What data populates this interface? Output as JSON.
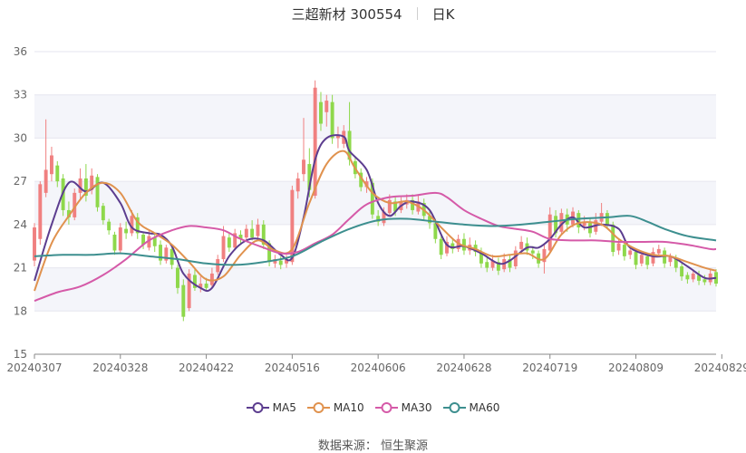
{
  "title": {
    "name": "三超新材 300554",
    "period": "日K"
  },
  "source": "数据来源： 恒生聚源",
  "colors": {
    "up": "#f08080",
    "down": "#8ed84b",
    "grid": "#e6e6ef",
    "band": "#f4f5fa",
    "axis": "#888888"
  },
  "chart_data": {
    "type": "candlestick",
    "ylim": [
      15,
      36
    ],
    "yticks": [
      15,
      18,
      21,
      24,
      27,
      30,
      33,
      36
    ],
    "x_tick_labels": [
      {
        "index": 0,
        "label": "20240307"
      },
      {
        "index": 15,
        "label": "20240328"
      },
      {
        "index": 30,
        "label": "20240422"
      },
      {
        "index": 45,
        "label": "20240516"
      },
      {
        "index": 60,
        "label": "20240606"
      },
      {
        "index": 75,
        "label": "20240628"
      },
      {
        "index": 90,
        "label": "20240719"
      },
      {
        "index": 105,
        "label": "20240809"
      },
      {
        "index": 120,
        "label": "20240829"
      }
    ],
    "candles": [
      [
        21.5,
        23.8,
        21.1,
        24.1
      ],
      [
        23.0,
        26.8,
        22.6,
        27.0
      ],
      [
        26.2,
        27.8,
        25.9,
        31.3
      ],
      [
        27.5,
        28.8,
        27.0,
        29.4
      ],
      [
        28.1,
        27.0,
        26.6,
        28.4
      ],
      [
        27.2,
        25.0,
        24.6,
        27.5
      ],
      [
        25.0,
        24.5,
        24.0,
        25.6
      ],
      [
        24.5,
        26.2,
        24.3,
        26.5
      ],
      [
        26.2,
        27.2,
        25.8,
        27.9
      ],
      [
        27.2,
        26.0,
        25.6,
        28.2
      ],
      [
        26.4,
        27.4,
        26.1,
        27.9
      ],
      [
        27.3,
        25.2,
        24.9,
        27.5
      ],
      [
        25.3,
        24.3,
        24.0,
        25.5
      ],
      [
        24.2,
        23.6,
        23.3,
        24.4
      ],
      [
        23.3,
        22.2,
        21.9,
        23.5
      ],
      [
        22.2,
        23.8,
        22.0,
        24.1
      ],
      [
        23.7,
        23.4,
        23.0,
        24.2
      ],
      [
        23.4,
        24.6,
        23.2,
        25.0
      ],
      [
        24.5,
        23.4,
        23.0,
        24.8
      ],
      [
        23.3,
        22.6,
        22.3,
        23.5
      ],
      [
        22.4,
        23.2,
        22.2,
        23.6
      ],
      [
        23.1,
        22.5,
        22.1,
        23.3
      ],
      [
        22.6,
        21.5,
        21.2,
        22.9
      ],
      [
        21.5,
        22.4,
        21.3,
        22.6
      ],
      [
        22.3,
        21.2,
        20.9,
        22.5
      ],
      [
        21.0,
        19.6,
        19.2,
        21.2
      ],
      [
        19.8,
        17.6,
        17.3,
        20.2
      ],
      [
        18.2,
        20.6,
        18.0,
        20.9
      ],
      [
        20.5,
        19.6,
        19.4,
        21.0
      ],
      [
        19.6,
        19.9,
        19.3,
        20.4
      ],
      [
        19.9,
        19.6,
        19.4,
        20.3
      ],
      [
        19.8,
        20.6,
        19.6,
        21.0
      ],
      [
        20.7,
        21.6,
        20.5,
        21.9
      ],
      [
        21.6,
        23.2,
        21.4,
        23.9
      ],
      [
        23.1,
        22.4,
        22.1,
        23.4
      ],
      [
        22.4,
        23.4,
        22.2,
        23.7
      ],
      [
        23.3,
        23.0,
        22.7,
        23.6
      ],
      [
        23.1,
        23.7,
        22.9,
        24.0
      ],
      [
        23.7,
        23.1,
        22.9,
        24.3
      ],
      [
        23.2,
        24.0,
        23.0,
        24.4
      ],
      [
        24.0,
        22.6,
        22.3,
        24.3
      ],
      [
        22.7,
        21.4,
        21.1,
        22.9
      ],
      [
        21.3,
        21.6,
        21.0,
        21.9
      ],
      [
        21.5,
        21.2,
        20.9,
        21.8
      ],
      [
        21.3,
        21.6,
        21.0,
        21.9
      ],
      [
        21.4,
        26.4,
        21.2,
        26.7
      ],
      [
        26.3,
        27.2,
        25.8,
        27.6
      ],
      [
        27.5,
        28.5,
        27.0,
        31.4
      ],
      [
        28.2,
        26.4,
        25.9,
        29.3
      ],
      [
        26.0,
        33.5,
        25.8,
        34.0
      ],
      [
        32.5,
        31.0,
        30.5,
        33.2
      ],
      [
        31.8,
        32.6,
        30.8,
        33.0
      ],
      [
        32.5,
        30.0,
        29.6,
        33.0
      ],
      [
        30.0,
        30.2,
        29.3,
        30.8
      ],
      [
        29.6,
        30.5,
        29.3,
        30.9
      ],
      [
        30.5,
        28.5,
        28.1,
        32.5
      ],
      [
        28.4,
        27.5,
        27.2,
        28.7
      ],
      [
        27.6,
        26.6,
        26.3,
        27.9
      ],
      [
        26.6,
        27.0,
        26.2,
        27.3
      ],
      [
        26.9,
        24.7,
        24.4,
        27.2
      ],
      [
        24.6,
        24.2,
        23.9,
        25.0
      ],
      [
        24.1,
        24.9,
        23.9,
        25.2
      ],
      [
        24.8,
        25.7,
        24.6,
        26.1
      ],
      [
        25.6,
        24.9,
        24.6,
        25.9
      ],
      [
        25.0,
        25.6,
        24.8,
        25.9
      ],
      [
        25.4,
        25.7,
        25.1,
        26.1
      ],
      [
        25.7,
        25.0,
        24.7,
        26.1
      ],
      [
        24.9,
        25.6,
        24.7,
        26.0
      ],
      [
        25.5,
        24.6,
        24.3,
        25.8
      ],
      [
        24.6,
        24.1,
        23.7,
        25.0
      ],
      [
        24.1,
        23.0,
        22.7,
        24.4
      ],
      [
        23.0,
        21.9,
        21.6,
        23.2
      ],
      [
        22.0,
        22.8,
        21.8,
        23.2
      ],
      [
        22.7,
        22.3,
        22.0,
        23.0
      ],
      [
        22.3,
        23.0,
        22.1,
        23.3
      ],
      [
        23.0,
        22.2,
        21.9,
        23.4
      ],
      [
        22.2,
        22.6,
        21.9,
        23.1
      ],
      [
        22.6,
        22.1,
        21.8,
        22.9
      ],
      [
        22.1,
        21.3,
        21.0,
        22.4
      ],
      [
        21.4,
        21.0,
        20.7,
        21.7
      ],
      [
        21.0,
        21.5,
        20.8,
        21.9
      ],
      [
        21.4,
        20.8,
        20.5,
        21.7
      ],
      [
        20.9,
        21.6,
        20.7,
        22.0
      ],
      [
        21.6,
        21.0,
        20.7,
        21.9
      ],
      [
        21.1,
        22.2,
        20.9,
        22.5
      ],
      [
        22.3,
        22.8,
        22.0,
        23.2
      ],
      [
        22.7,
        22.2,
        21.9,
        23.1
      ],
      [
        22.2,
        22.0,
        21.6,
        22.5
      ],
      [
        22.0,
        21.3,
        21.0,
        22.2
      ],
      [
        21.4,
        22.3,
        20.6,
        22.6
      ],
      [
        22.2,
        24.7,
        22.0,
        25.2
      ],
      [
        24.6,
        23.4,
        23.1,
        25.0
      ],
      [
        23.5,
        24.8,
        23.3,
        25.1
      ],
      [
        24.7,
        24.0,
        23.5,
        25.1
      ],
      [
        24.0,
        24.9,
        23.8,
        25.2
      ],
      [
        24.8,
        23.8,
        23.4,
        25.0
      ],
      [
        23.9,
        24.2,
        23.6,
        24.6
      ],
      [
        24.1,
        23.4,
        23.1,
        24.4
      ],
      [
        23.5,
        24.3,
        23.3,
        24.8
      ],
      [
        24.2,
        24.8,
        23.9,
        25.5
      ],
      [
        24.8,
        24.0,
        23.7,
        25.0
      ],
      [
        24.0,
        22.1,
        21.8,
        24.2
      ],
      [
        22.2,
        22.7,
        21.9,
        23.0
      ],
      [
        22.6,
        21.8,
        21.5,
        22.9
      ],
      [
        21.9,
        22.2,
        21.6,
        22.5
      ],
      [
        22.1,
        21.2,
        20.9,
        22.3
      ],
      [
        21.3,
        21.9,
        21.1,
        22.1
      ],
      [
        21.8,
        21.2,
        20.9,
        22.0
      ],
      [
        21.3,
        22.1,
        21.1,
        22.4
      ],
      [
        22.0,
        22.3,
        21.8,
        22.6
      ],
      [
        22.2,
        21.3,
        21.0,
        22.4
      ],
      [
        21.4,
        21.8,
        21.1,
        22.0
      ],
      [
        21.7,
        21.0,
        20.7,
        21.9
      ],
      [
        21.1,
        20.4,
        20.1,
        21.3
      ],
      [
        20.5,
        20.2,
        19.9,
        20.7
      ],
      [
        20.2,
        20.6,
        20.0,
        20.9
      ],
      [
        20.5,
        20.1,
        19.8,
        20.8
      ],
      [
        20.2,
        20.0,
        19.8,
        20.5
      ],
      [
        20.0,
        20.6,
        19.8,
        20.9
      ],
      [
        20.7,
        19.9,
        19.7,
        20.9
      ]
    ],
    "series": [
      {
        "name": "MA5",
        "color": "#5c3d8f",
        "points": [
          [
            0,
            20.1
          ],
          [
            3,
            24.0
          ],
          [
            6,
            26.9
          ],
          [
            9,
            26.3
          ],
          [
            12,
            26.9
          ],
          [
            15,
            25.5
          ],
          [
            17,
            23.8
          ],
          [
            20,
            23.4
          ],
          [
            22,
            23.3
          ],
          [
            24,
            22.5
          ],
          [
            26,
            20.6
          ],
          [
            29,
            19.6
          ],
          [
            31,
            19.6
          ],
          [
            34,
            21.8
          ],
          [
            37,
            22.9
          ],
          [
            40,
            22.9
          ],
          [
            43,
            21.9
          ],
          [
            45,
            21.7
          ],
          [
            47,
            24.5
          ],
          [
            49,
            28.5
          ],
          [
            51,
            30.0
          ],
          [
            54,
            30.1
          ],
          [
            55,
            29.1
          ],
          [
            58,
            27.8
          ],
          [
            60,
            25.5
          ],
          [
            62,
            24.6
          ],
          [
            64,
            25.3
          ],
          [
            66,
            25.6
          ],
          [
            69,
            25.0
          ],
          [
            72,
            22.6
          ],
          [
            75,
            22.5
          ],
          [
            78,
            22.0
          ],
          [
            81,
            21.3
          ],
          [
            83,
            21.5
          ],
          [
            86,
            22.4
          ],
          [
            88,
            22.4
          ],
          [
            90,
            23.0
          ],
          [
            92,
            24.0
          ],
          [
            94,
            24.5
          ],
          [
            96,
            23.8
          ],
          [
            99,
            24.0
          ],
          [
            102,
            23.7
          ],
          [
            104,
            22.4
          ],
          [
            108,
            21.8
          ],
          [
            111,
            21.8
          ],
          [
            114,
            21.1
          ],
          [
            117,
            20.3
          ],
          [
            119,
            20.3
          ]
        ]
      },
      {
        "name": "MA10",
        "color": "#e0924e",
        "points": [
          [
            0,
            19.4
          ],
          [
            3,
            22.7
          ],
          [
            6,
            24.6
          ],
          [
            9,
            26.2
          ],
          [
            12,
            26.9
          ],
          [
            15,
            26.2
          ],
          [
            18,
            24.2
          ],
          [
            21,
            23.4
          ],
          [
            24,
            22.6
          ],
          [
            27,
            21.4
          ],
          [
            30,
            20.2
          ],
          [
            33,
            20.4
          ],
          [
            36,
            21.9
          ],
          [
            39,
            22.9
          ],
          [
            42,
            22.2
          ],
          [
            45,
            22.3
          ],
          [
            48,
            25.5
          ],
          [
            51,
            28.2
          ],
          [
            54,
            29.1
          ],
          [
            56,
            27.9
          ],
          [
            59,
            26.2
          ],
          [
            62,
            25.5
          ],
          [
            65,
            25.6
          ],
          [
            68,
            25.0
          ],
          [
            71,
            23.8
          ],
          [
            74,
            22.7
          ],
          [
            77,
            22.3
          ],
          [
            80,
            21.8
          ],
          [
            83,
            21.9
          ],
          [
            86,
            22.0
          ],
          [
            89,
            21.6
          ],
          [
            92,
            23.3
          ],
          [
            95,
            24.1
          ],
          [
            99,
            24.0
          ],
          [
            102,
            23.0
          ],
          [
            105,
            22.3
          ],
          [
            108,
            21.9
          ],
          [
            111,
            21.8
          ],
          [
            114,
            21.4
          ],
          [
            117,
            21.0
          ],
          [
            119,
            20.8
          ]
        ]
      },
      {
        "name": "MA30",
        "color": "#d55aa8",
        "points": [
          [
            0,
            18.7
          ],
          [
            4,
            19.3
          ],
          [
            8,
            19.7
          ],
          [
            12,
            20.5
          ],
          [
            16,
            21.6
          ],
          [
            20,
            22.9
          ],
          [
            24,
            23.6
          ],
          [
            27,
            23.9
          ],
          [
            30,
            23.8
          ],
          [
            33,
            23.6
          ],
          [
            36,
            23.0
          ],
          [
            40,
            22.4
          ],
          [
            43,
            22.0
          ],
          [
            46,
            22.1
          ],
          [
            49,
            22.7
          ],
          [
            52,
            23.3
          ],
          [
            55,
            24.4
          ],
          [
            58,
            25.4
          ],
          [
            62,
            25.9
          ],
          [
            66,
            26.0
          ],
          [
            70,
            26.2
          ],
          [
            72,
            25.9
          ],
          [
            75,
            25.0
          ],
          [
            78,
            24.4
          ],
          [
            81,
            23.9
          ],
          [
            84,
            23.7
          ],
          [
            87,
            23.5
          ],
          [
            90,
            23.0
          ],
          [
            94,
            22.9
          ],
          [
            98,
            22.9
          ],
          [
            102,
            22.8
          ],
          [
            106,
            22.8
          ],
          [
            110,
            22.8
          ],
          [
            114,
            22.6
          ],
          [
            118,
            22.3
          ],
          [
            119,
            22.3
          ]
        ]
      },
      {
        "name": "MA60",
        "color": "#3d8f8f",
        "points": [
          [
            0,
            21.8
          ],
          [
            5,
            21.9
          ],
          [
            10,
            21.9
          ],
          [
            15,
            22.0
          ],
          [
            20,
            21.8
          ],
          [
            25,
            21.6
          ],
          [
            30,
            21.3
          ],
          [
            35,
            21.2
          ],
          [
            40,
            21.4
          ],
          [
            45,
            21.8
          ],
          [
            50,
            22.8
          ],
          [
            55,
            23.7
          ],
          [
            60,
            24.3
          ],
          [
            65,
            24.4
          ],
          [
            70,
            24.2
          ],
          [
            75,
            24.0
          ],
          [
            80,
            23.9
          ],
          [
            85,
            24.0
          ],
          [
            90,
            24.2
          ],
          [
            95,
            24.4
          ],
          [
            100,
            24.5
          ],
          [
            104,
            24.6
          ],
          [
            107,
            24.2
          ],
          [
            110,
            23.7
          ],
          [
            114,
            23.2
          ],
          [
            119,
            22.9
          ]
        ]
      }
    ]
  }
}
